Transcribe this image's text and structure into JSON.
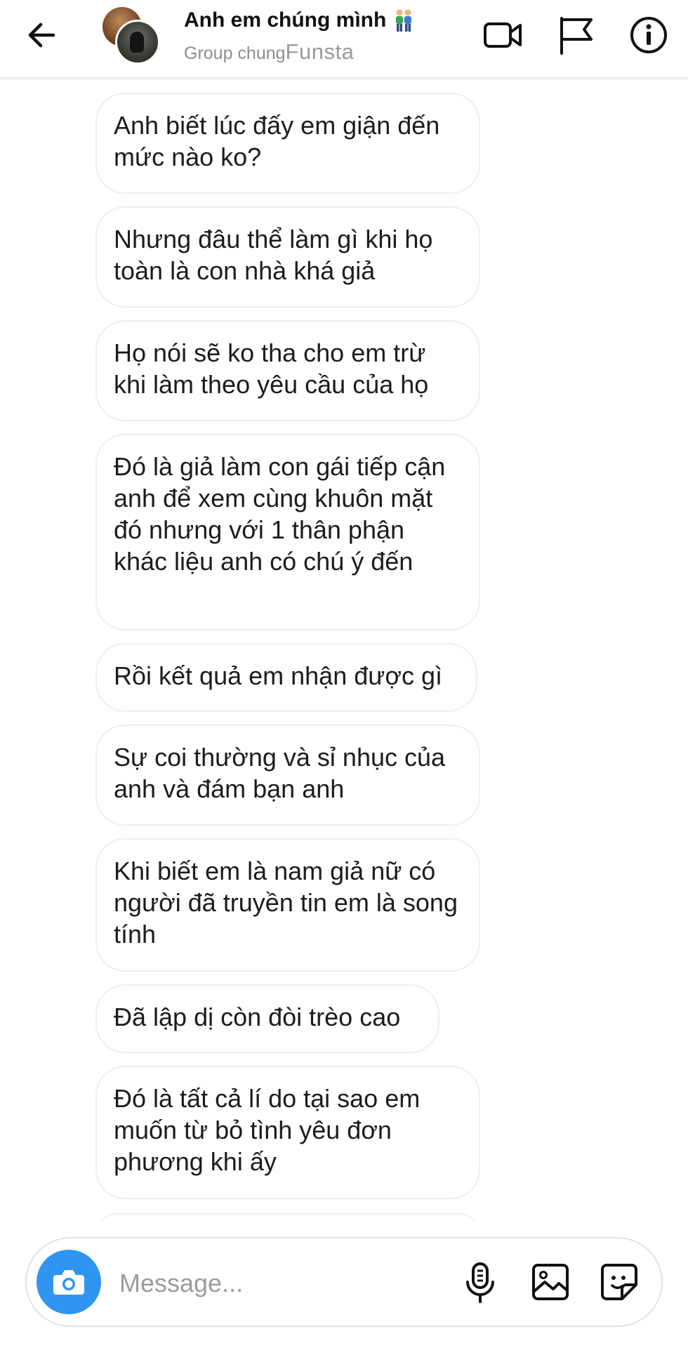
{
  "header": {
    "title": "Anh em chúng mình",
    "subtitle": "Group chung",
    "watermark": "Funsta",
    "icons": {
      "back": "arrow-left-icon",
      "video": "video-camera-icon",
      "flag": "flag-icon",
      "info": "info-icon",
      "title_emoji": "two-people-emoji"
    }
  },
  "messages": [
    {
      "text": "Anh biết lúc đấy em giận đến mức nào ko?"
    },
    {
      "text": "Nhưng đâu thể làm gì khi họ toàn là con nhà khá giả"
    },
    {
      "text": "Họ nói sẽ ko tha cho em trừ khi làm theo yêu cầu của họ"
    },
    {
      "text": "Đó là giả làm con gái tiếp cận anh để xem cùng khuôn mặt đó nhưng với 1 thân phận khác liệu anh có chú ý đến"
    },
    {
      "text": "Rồi kết quả em nhận được gì"
    },
    {
      "text": "Sự coi thường và sỉ nhục của anh và đám bạn anh"
    },
    {
      "text": "Khi biết em là nam giả nữ có người đã truyền tin em là song tính"
    },
    {
      "text": "Đã lập dị còn đòi trèo cao"
    },
    {
      "text": "Đó là tất cả lí do tại sao em muốn từ bỏ tình yêu đơn phương khi ấy"
    }
  ],
  "composer": {
    "placeholder": "Message...",
    "icons": {
      "camera": "camera-icon",
      "mic": "microphone-icon",
      "gallery": "image-icon",
      "sticker": "sticker-icon"
    }
  },
  "colors": {
    "accent": "#2f95f0",
    "bubble_border": "#efefef",
    "muted_text": "#8e8e8e"
  }
}
